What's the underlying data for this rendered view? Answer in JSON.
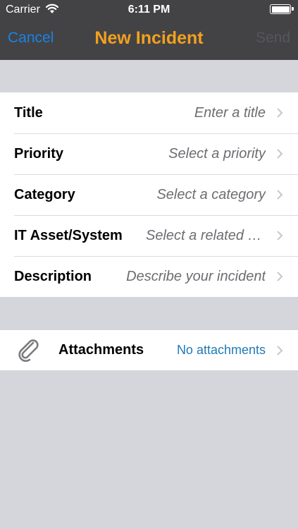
{
  "status_bar": {
    "carrier": "Carrier",
    "time": "6:11 PM",
    "battery_level": 1.0
  },
  "nav": {
    "cancel_label": "Cancel",
    "title": "New Incident",
    "send_label": "Send"
  },
  "form": {
    "rows": [
      {
        "label": "Title",
        "value": "Enter a title"
      },
      {
        "label": "Priority",
        "value": "Select a priority"
      },
      {
        "label": "Category",
        "value": "Select a category"
      },
      {
        "label": "IT Asset/System",
        "value": "Select a related asset"
      },
      {
        "label": "Description",
        "value": "Describe your incident"
      }
    ]
  },
  "attachments": {
    "label": "Attachments",
    "value": "No attachments"
  },
  "colors": {
    "nav_background": "#434346",
    "accent_blue": "#1a82e6",
    "title_orange": "#f2a11e",
    "page_background": "#d4d6dc"
  },
  "icons": {
    "wifi": "wifi-icon",
    "battery": "battery-icon",
    "chevron": "chevron-right-icon",
    "attachment": "paperclip-icon"
  }
}
